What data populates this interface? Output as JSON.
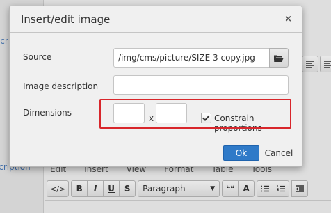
{
  "background": {
    "side_label_top": "scr",
    "side_label_bottom": "scription",
    "menubar": [
      "Edit",
      "Insert",
      "View",
      "Format",
      "Table",
      "Tools"
    ],
    "toolbar": {
      "source_code": "</>",
      "bold": "B",
      "italic": "I",
      "underline": "U",
      "strikethrough": "S",
      "format_select": "Paragraph",
      "blockquote": "❝❝",
      "font_color": "A"
    }
  },
  "dialog": {
    "title": "Insert/edit image",
    "close_glyph": "×",
    "source": {
      "label": "Source",
      "value": "/img/cms/picture/SIZE 3  copy.jpg"
    },
    "image_description": {
      "label": "Image description",
      "value": ""
    },
    "dimensions": {
      "label": "Dimensions",
      "width": "",
      "height": "",
      "separator": "x",
      "constrain_label": "Constrain proportions",
      "constrain_checked": true
    },
    "ok_label": "Ok",
    "cancel_label": "Cancel"
  },
  "colors": {
    "highlight": "#d8262b",
    "primary_button": "#2f7ac8"
  }
}
